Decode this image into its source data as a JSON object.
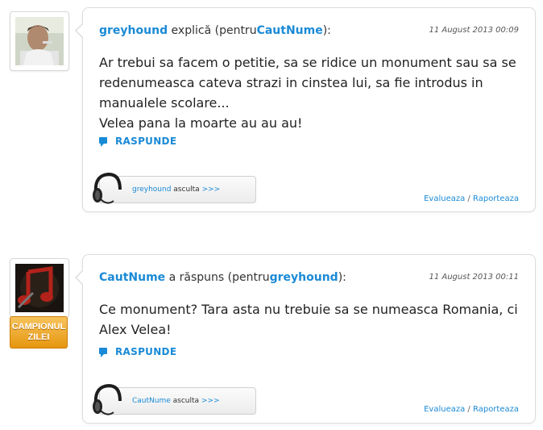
{
  "comments": [
    {
      "username": "greyhound",
      "verb": "explică",
      "pentru_label": "(pentru",
      "target": "CautNume",
      "close": "):",
      "date": "11 August 2013 00:09",
      "message_lines": [
        "Ar trebui sa facem o petitie, sa se ridice un monument sau sa se",
        "redenumeasca cateva strazi in cinstea lui, sa fie introdus in",
        "manualele scolare...",
        "Velea pana la moarte au au au!"
      ],
      "reply_label": "RASPUNDE",
      "listen_user": "greyhound",
      "listen_label": "asculta",
      "listen_arrows": ">>>",
      "rate_label": "Evalueaza",
      "separator": "/",
      "report_label": "Raporteaza"
    },
    {
      "username": "CautNume",
      "verb": "a răspuns",
      "pentru_label": "(pentru",
      "target": "greyhound",
      "close": "):",
      "date": "11 August 2013 00:11",
      "message_lines": [
        "Ce monument? Tara asta nu trebuie sa se numeasca Romania, ci",
        "Alex Velea!"
      ],
      "reply_label": "RASPUNDE",
      "badge_line1": "CAMPIONUL",
      "badge_line2": "ZILEI",
      "listen_user": "CautNume",
      "listen_label": "asculta",
      "listen_arrows": ">>>",
      "rate_label": "Evalueaza",
      "separator": "/",
      "report_label": "Raporteaza"
    }
  ]
}
